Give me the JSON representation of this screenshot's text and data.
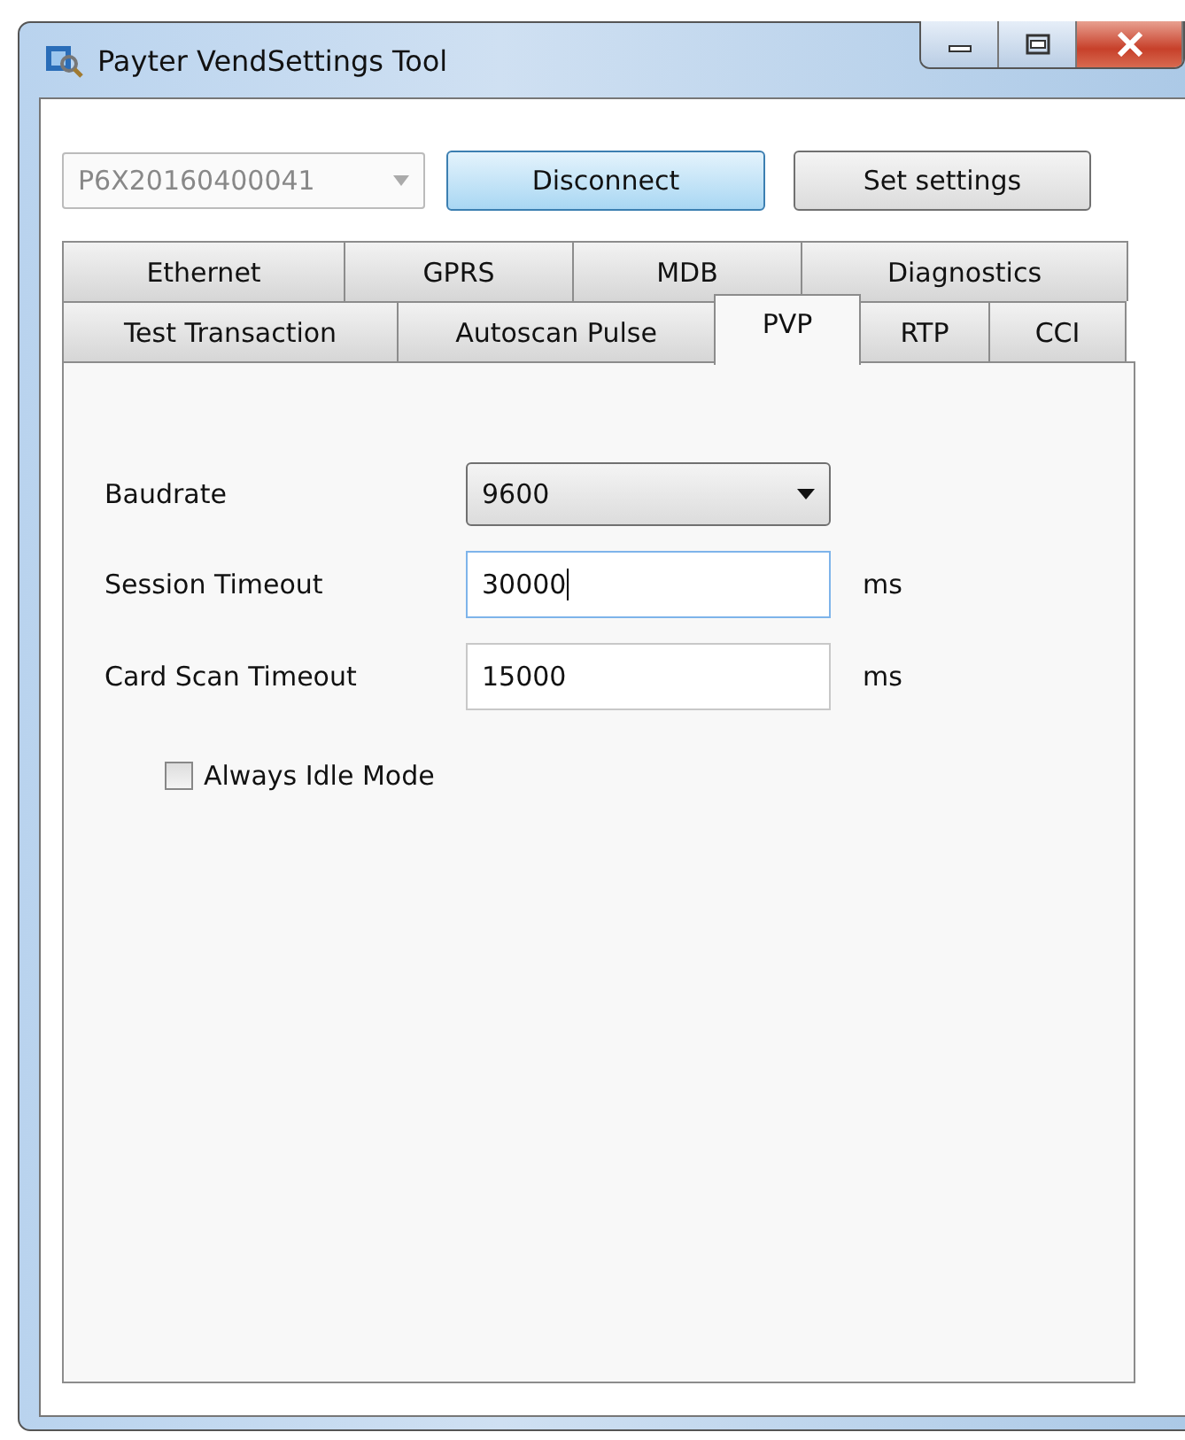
{
  "window": {
    "title": "Payter VendSettings Tool"
  },
  "toolbar": {
    "device": {
      "value": "P6X20160400041",
      "disabled": true
    },
    "buttons": [
      {
        "label": "Disconnect",
        "highlighted": true
      },
      {
        "label": "Set settings",
        "highlighted": false
      }
    ]
  },
  "tab_rows": [
    [
      {
        "label": "Ethernet",
        "selected": false
      },
      {
        "label": "GPRS",
        "selected": false
      },
      {
        "label": "MDB",
        "selected": false
      },
      {
        "label": "Diagnostics",
        "selected": false
      }
    ],
    [
      {
        "label": "Test Transaction",
        "selected": false
      },
      {
        "label": "Autoscan Pulse",
        "selected": false
      },
      {
        "label": "PVP",
        "selected": true
      },
      {
        "label": "RTP",
        "selected": false
      },
      {
        "label": "CCI",
        "selected": false
      }
    ]
  ],
  "fields": [
    {
      "kind": "dropdown",
      "label": "Baudrate",
      "value": "9600"
    },
    {
      "kind": "text",
      "label": "Session Timeout",
      "value": "30000",
      "unit": "ms",
      "focused": true
    },
    {
      "kind": "text",
      "label": "Card Scan Timeout",
      "value": "15000",
      "unit": "ms",
      "focused": false
    }
  ],
  "checkbox": {
    "label": "Always Idle Mode",
    "checked": false
  }
}
